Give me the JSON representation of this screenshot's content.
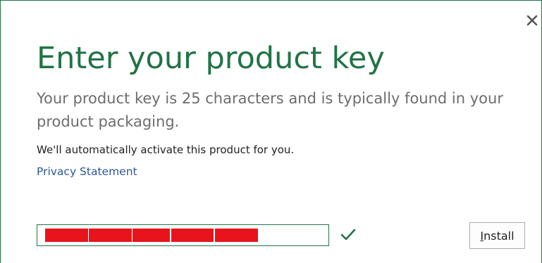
{
  "dialog": {
    "title": "Enter your product key",
    "description": "Your product key is 25 characters and is typically found in your product packaging.",
    "auto_activate_text": "We'll automatically activate this product for you.",
    "privacy_link_text": "Privacy Statement",
    "close_icon": "close-icon"
  },
  "product_key": {
    "value": "",
    "status": "valid",
    "status_icon": "checkmark-icon",
    "status_color": "#217346",
    "redaction_color": "#e8141c"
  },
  "install_button": {
    "access_key": "I",
    "label_rest": "nstall"
  },
  "colors": {
    "accent": "#217346",
    "link": "#2b579a",
    "body_text": "#6d6d6d"
  }
}
